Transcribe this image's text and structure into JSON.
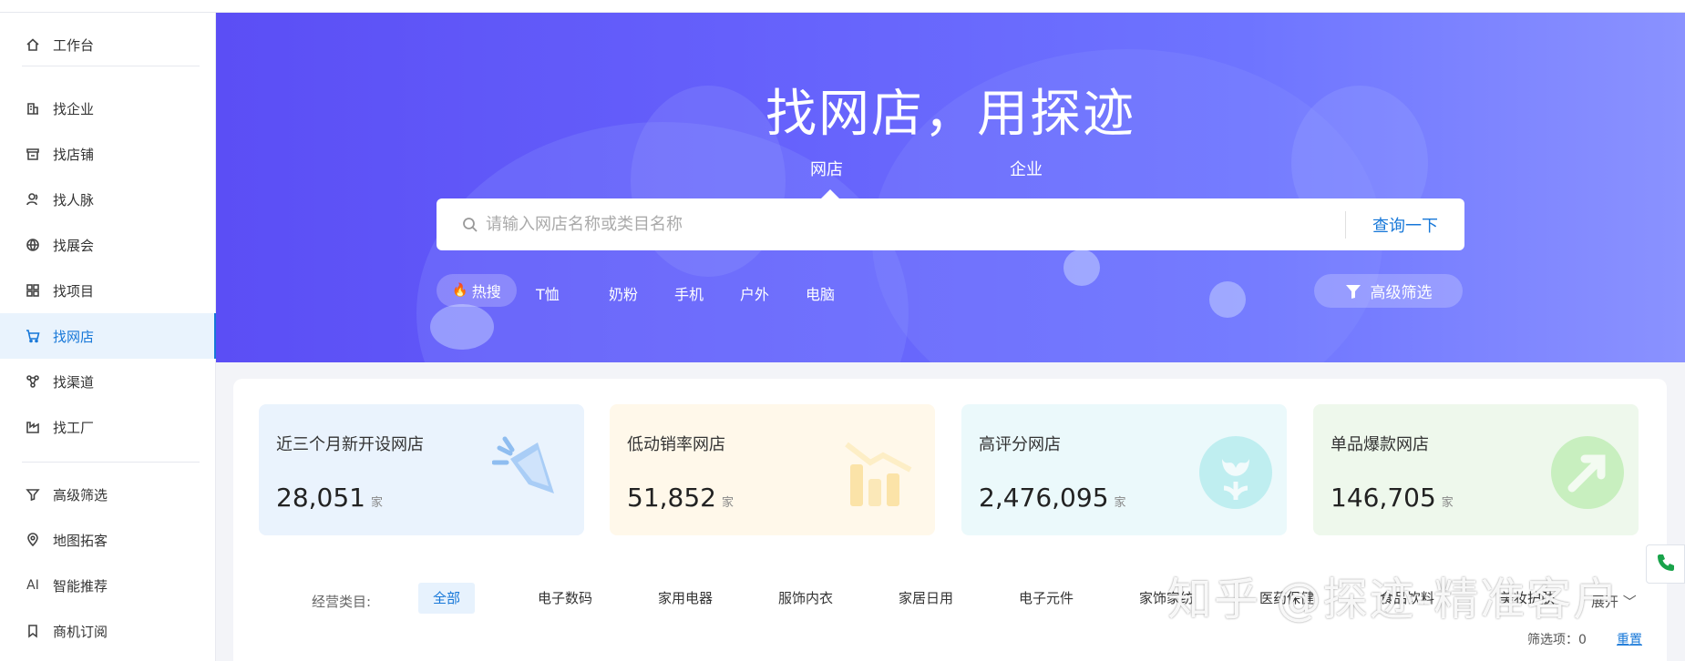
{
  "sidebar": {
    "items": [
      {
        "label": "工作台",
        "icon": "home-icon"
      },
      {
        "label": "找企业",
        "icon": "building-icon"
      },
      {
        "label": "找店铺",
        "icon": "store-icon"
      },
      {
        "label": "找人脉",
        "icon": "people-icon"
      },
      {
        "label": "找展会",
        "icon": "globe-icon"
      },
      {
        "label": "找项目",
        "icon": "grid-icon"
      },
      {
        "label": "找网店",
        "icon": "cart-icon",
        "active": true
      },
      {
        "label": "找渠道",
        "icon": "channel-icon"
      },
      {
        "label": "找工厂",
        "icon": "factory-icon"
      },
      {
        "label": "高级筛选",
        "icon": "filter-icon"
      },
      {
        "label": "地图拓客",
        "icon": "map-pin-icon"
      },
      {
        "label": "智能推荐",
        "icon": "ai-icon"
      },
      {
        "label": "商机订阅",
        "icon": "bookmark-icon"
      }
    ]
  },
  "hero": {
    "title": "找网店，用探迹",
    "tabs": [
      {
        "label": "网店",
        "active": true
      },
      {
        "label": "企业"
      }
    ],
    "search": {
      "placeholder": "请输入网店名称或类目名称",
      "button": "查询一下"
    },
    "hot_label": "热搜",
    "hot_tags": [
      "T恤",
      "奶粉",
      "手机",
      "户外",
      "电脑"
    ],
    "advanced_filter": "高级筛选"
  },
  "stats": [
    {
      "title": "近三个月新开设网店",
      "value": "28,051",
      "unit": "家",
      "icon": "megaphone-icon"
    },
    {
      "title": "低动销率网店",
      "value": "51,852",
      "unit": "家",
      "icon": "bar-chart-icon"
    },
    {
      "title": "高评分网店",
      "value": "2,476,095",
      "unit": "家",
      "icon": "flower-icon"
    },
    {
      "title": "单品爆款网店",
      "value": "146,705",
      "unit": "家",
      "icon": "arrow-up-icon"
    }
  ],
  "categories": {
    "label": "经营类目:",
    "items": [
      "全部",
      "电子数码",
      "家用电器",
      "服饰内衣",
      "家居日用",
      "电子元件",
      "家饰家纺",
      "医药保健",
      "食品饮料",
      "美妆护肤"
    ],
    "expand": "展开"
  },
  "filter": {
    "count_label": "筛选项：0",
    "reset": "重置"
  },
  "watermark": "知乎 @探迹-精准客户",
  "colors": {
    "accent": "#1677d8",
    "hero_start": "#5b4ef5",
    "hero_end": "#8a92ff"
  }
}
